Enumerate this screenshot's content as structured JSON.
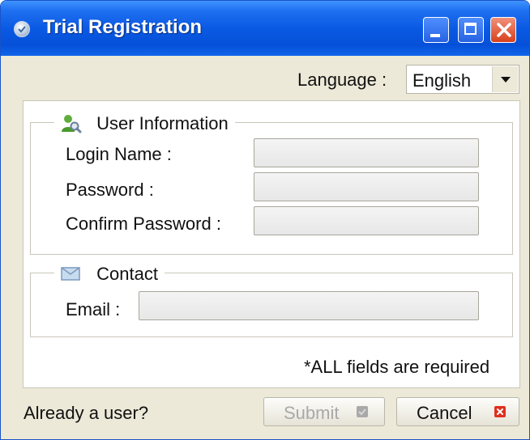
{
  "window": {
    "title": "Trial Registration",
    "controls": [
      "minimize",
      "maximize",
      "close"
    ]
  },
  "language": {
    "label": "Language :",
    "selected": "English"
  },
  "user_information": {
    "heading": "User Information",
    "icon": "user-search-icon",
    "fields": [
      {
        "label": "Login Name :",
        "value": ""
      },
      {
        "label": "Password :",
        "value": ""
      },
      {
        "label": "Confirm Password :",
        "value": ""
      }
    ]
  },
  "contact": {
    "heading": "Contact",
    "icon": "envelope-icon",
    "email_label": "Email :",
    "email_value": ""
  },
  "required_note": "*ALL fields are required",
  "footer": {
    "already_user": "Already a user?",
    "submit_label": "Submit",
    "cancel_label": "Cancel"
  },
  "colors": {
    "titlebar": "#0b5ae4",
    "window_bg": "#ece9d8",
    "close_red": "#e0301e"
  }
}
